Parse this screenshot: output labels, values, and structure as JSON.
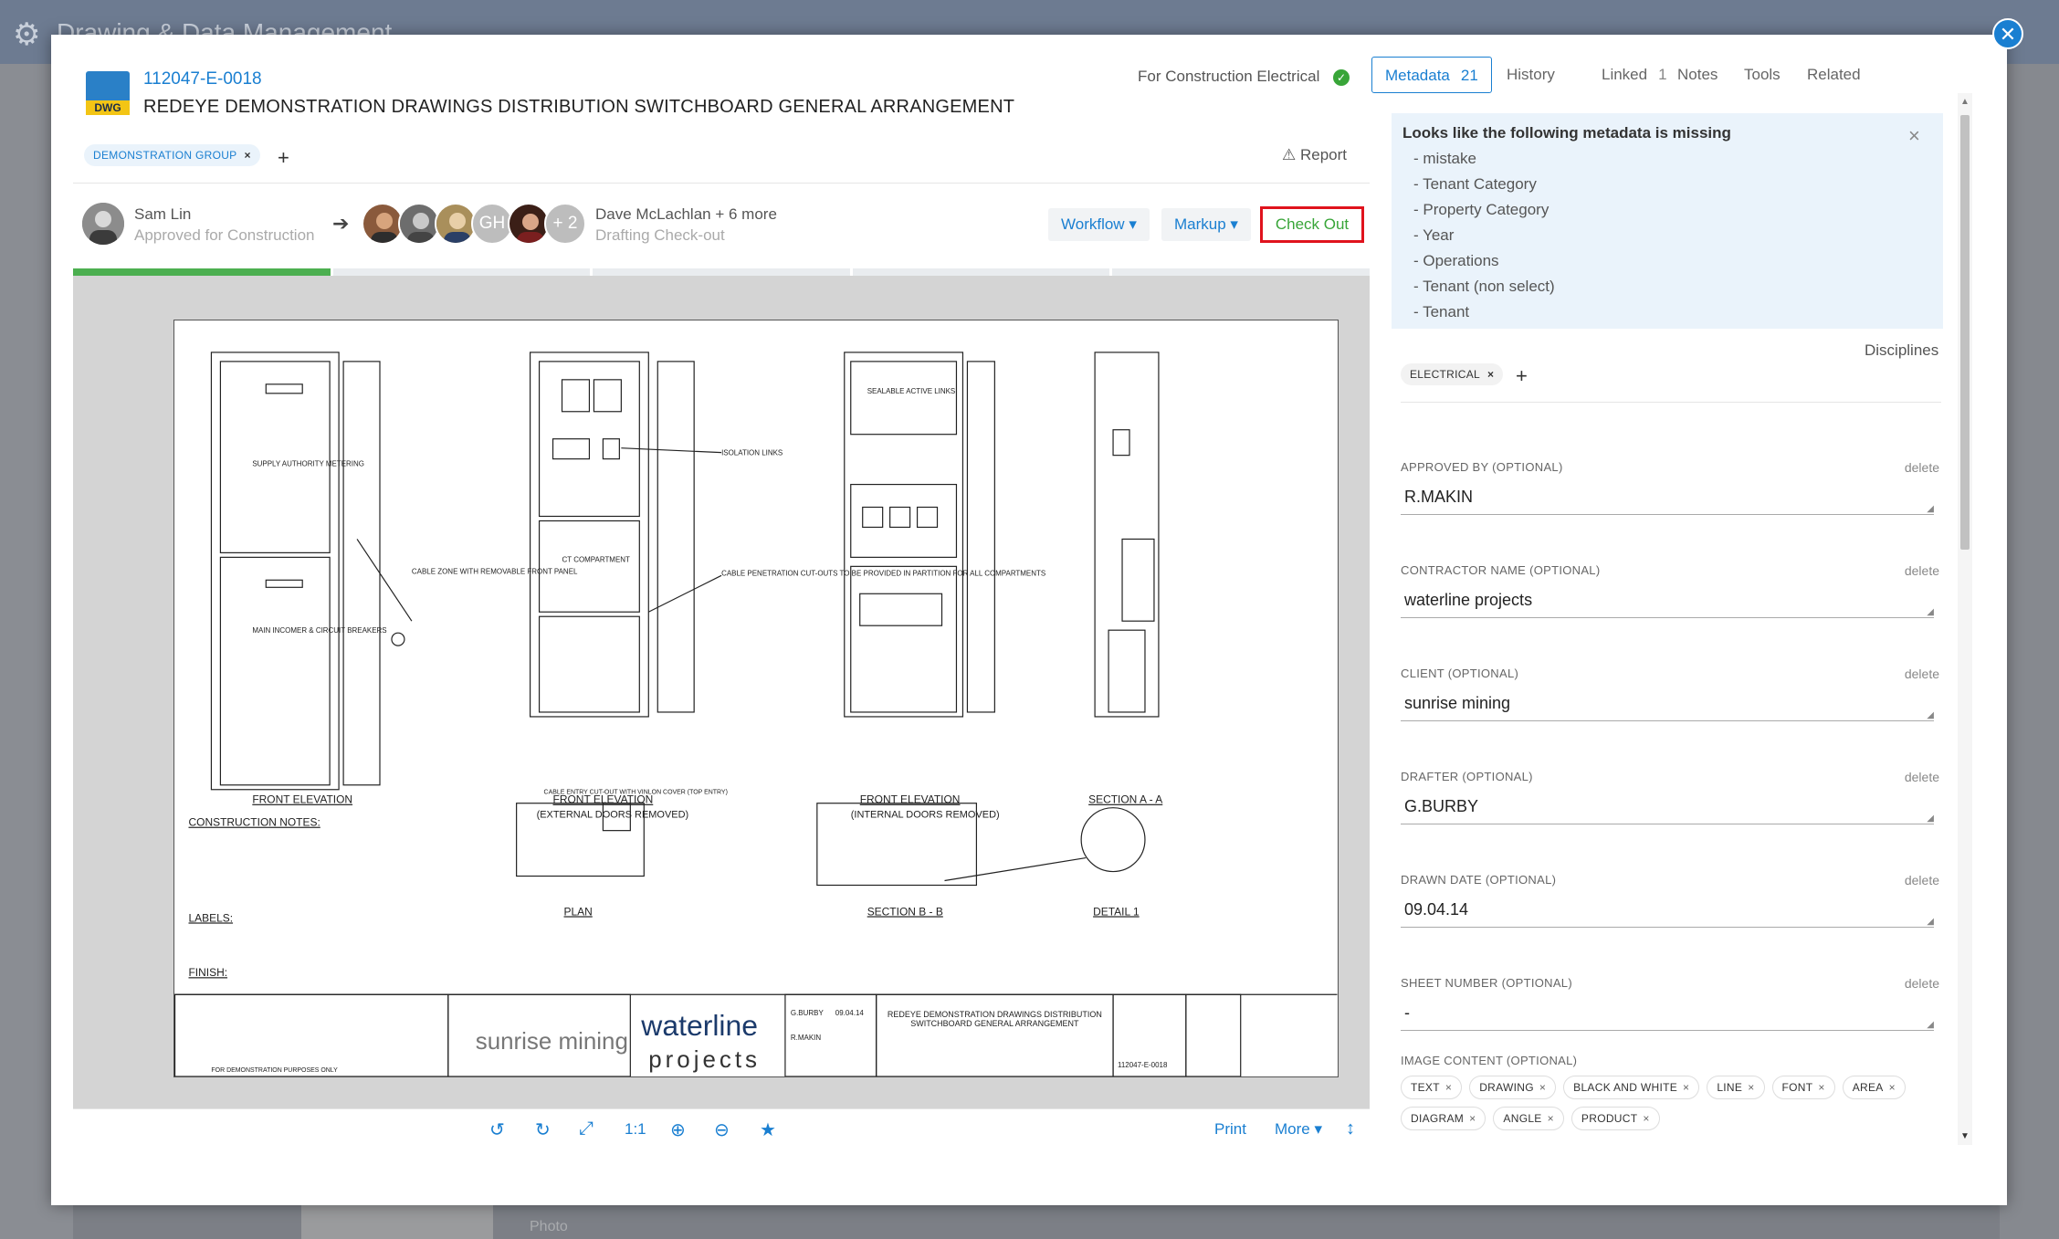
{
  "background": {
    "app_title": "Drawing & Data Management",
    "bottom_hint": "Photo"
  },
  "colors": {
    "accent": "#1a7fd1",
    "success": "#38a538",
    "highlight_border": "#e0131d",
    "progress_done": "#4caf50"
  },
  "document": {
    "icon_label": "DWG",
    "number": "112047-E-0018",
    "title": "REDEYE DEMONSTRATION DRAWINGS DISTRIBUTION SWITCHBOARD GENERAL ARRANGEMENT",
    "status": "For Construction Electrical",
    "group_tag": "DEMONSTRATION GROUP",
    "report_label": "Report"
  },
  "workflow": {
    "current": {
      "name": "Sam Lin",
      "role": "Approved for Construction"
    },
    "next_overflow": "+ 2",
    "next_initials": "GH",
    "next": {
      "name": "Dave McLachlan + 6 more",
      "role": "Drafting Check-out"
    },
    "buttons": {
      "workflow": "Workflow",
      "markup": "Markup",
      "checkout": "Check Out"
    },
    "progress": {
      "total_steps": 5,
      "completed_steps": 1
    }
  },
  "viewer": {
    "zoom_label": "1:1",
    "print_label": "Print",
    "more_label": "More",
    "drawing": {
      "views": [
        "FRONT ELEVATION",
        "FRONT ELEVATION",
        "(EXTERNAL DOORS REMOVED)",
        "FRONT ELEVATION",
        "(INTERNAL DOORS REMOVED)",
        "SECTION A - A",
        "PLAN",
        "SECTION B - B",
        "DETAIL 1"
      ],
      "notes_title": "CONSTRUCTION NOTES:",
      "labels_title": "LABELS:",
      "finish_title": "FINISH:",
      "client_name": "sunrise mining",
      "company_line1": "waterline",
      "company_line2": "projects",
      "title_block": "REDEYE DEMONSTRATION DRAWINGS DISTRIBUTION SWITCHBOARD GENERAL ARRANGEMENT",
      "drawing_no": "112047-E-0018",
      "drawn_by": "G.BURBY",
      "approved_by": "R.MAKIN",
      "date": "09.04.14",
      "callouts": [
        "SUPPLY AUTHORITY METERING",
        "MAIN INCOMER & CIRCUIT BREAKERS",
        "CABLE ZONE WITH REMOVABLE FRONT PANEL",
        "ISOLATION LINKS",
        "CT COMPARTMENT",
        "CABLE PENETRATION CUT-OUTS TO BE PROVIDED IN PARTITION FOR ALL COMPARTMENTS",
        "SEALABLE ACTIVE LINKS",
        "CABLE ENTRY CUT-OUT WITH VINLON COVER (TOP ENTRY)"
      ],
      "revision_note": "FOR DEMONSTRATION PURPOSES ONLY"
    }
  },
  "tabs": [
    {
      "label": "Metadata",
      "count": "21"
    },
    {
      "label": "History",
      "count": ""
    },
    {
      "label": "Linked",
      "count": "1"
    },
    {
      "label": "Notes",
      "count": ""
    },
    {
      "label": "Tools",
      "count": ""
    },
    {
      "label": "Related",
      "count": ""
    }
  ],
  "metadata": {
    "missing_title": "Looks like the following metadata is missing",
    "missing_items": [
      "- mistake",
      "- Tenant Category",
      "- Property Category",
      "- Year",
      "- Operations",
      "- Tenant (non select)",
      "- Tenant"
    ],
    "disciplines_label": "Disciplines",
    "discipline_tag": "ELECTRICAL",
    "delete_label": "delete",
    "fields": [
      {
        "label": "APPROVED BY (OPTIONAL)",
        "value": "R.MAKIN"
      },
      {
        "label": "CONTRACTOR NAME (OPTIONAL)",
        "value": "waterline projects"
      },
      {
        "label": "CLIENT (OPTIONAL)",
        "value": "sunrise mining"
      },
      {
        "label": "DRAFTER (OPTIONAL)",
        "value": "G.BURBY"
      },
      {
        "label": "DRAWN DATE (OPTIONAL)",
        "value": "09.04.14"
      },
      {
        "label": "SHEET NUMBER (OPTIONAL)",
        "value": "-"
      }
    ],
    "image_content_label": "IMAGE CONTENT (OPTIONAL)",
    "image_content_tags": [
      "TEXT",
      "DRAWING",
      "BLACK AND WHITE",
      "LINE",
      "FONT",
      "AREA",
      "DIAGRAM",
      "ANGLE",
      "PRODUCT"
    ]
  }
}
